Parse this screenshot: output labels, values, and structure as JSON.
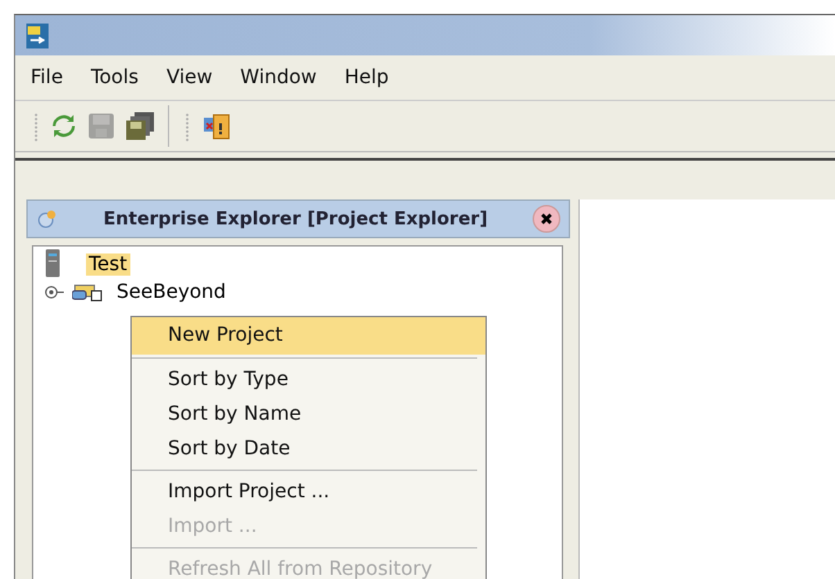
{
  "menu_bar": [
    {
      "label": "File"
    },
    {
      "label": "Tools"
    },
    {
      "label": "View"
    },
    {
      "label": "Window"
    },
    {
      "label": "Help"
    }
  ],
  "toolbar": [
    {
      "kind": "grip"
    },
    {
      "kind": "refresh",
      "disabled": false
    },
    {
      "kind": "save",
      "disabled": true
    },
    {
      "kind": "save-all",
      "disabled": false
    },
    {
      "kind": "break"
    },
    {
      "kind": "grip"
    },
    {
      "kind": "windows",
      "disabled": false
    }
  ],
  "explorer": {
    "title": "Enterprise Explorer [Project Explorer]",
    "tree": [
      {
        "kind": "server",
        "label": "Test",
        "selected": true,
        "children": [
          {
            "kind": "project",
            "label": "SeeBeyond",
            "selected": false,
            "expanded": false
          }
        ]
      }
    ]
  },
  "context_menu": [
    {
      "kind": "item",
      "label": "New Project",
      "selected": true,
      "disabled": false
    },
    {
      "kind": "separator"
    },
    {
      "kind": "item",
      "label": "Sort by Type",
      "selected": false,
      "disabled": false
    },
    {
      "kind": "item",
      "label": "Sort by Name",
      "selected": false,
      "disabled": false
    },
    {
      "kind": "item",
      "label": "Sort by Date",
      "selected": false,
      "disabled": false
    },
    {
      "kind": "separator"
    },
    {
      "kind": "item",
      "label": "Import Project ...",
      "selected": false,
      "disabled": false
    },
    {
      "kind": "item",
      "label": "Import ...",
      "selected": false,
      "disabled": true
    },
    {
      "kind": "separator"
    },
    {
      "kind": "item",
      "label": "Refresh All from Repository",
      "selected": false,
      "disabled": true
    }
  ]
}
